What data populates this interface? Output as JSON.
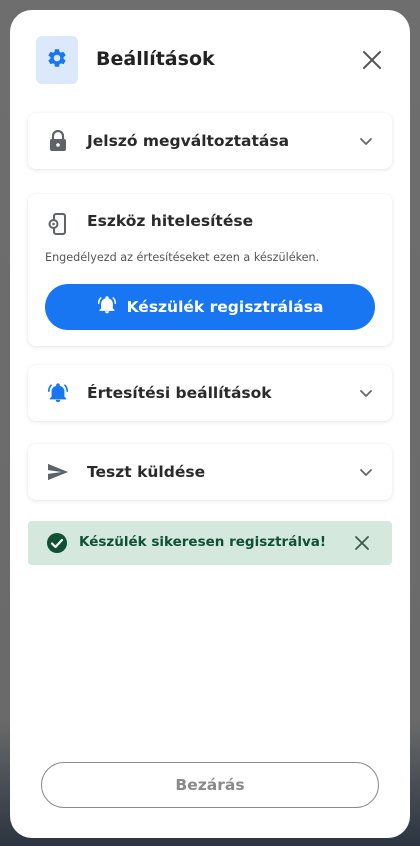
{
  "header": {
    "title": "Beállítások",
    "icon": "gear-icon",
    "close_icon": "close-icon"
  },
  "sections": {
    "password": {
      "label": "Jelszó megváltoztatása",
      "icon": "lock-icon"
    },
    "device": {
      "title": "Eszköz hitelesítése",
      "description": "Engedélyezd az értesítéseket ezen a készüléken.",
      "icon": "phone-settings-icon",
      "register_button": "Készülék regisztrálása",
      "register_icon": "bell-icon"
    },
    "notifications": {
      "label": "Értesítési beállítások",
      "icon": "bell-icon"
    },
    "test": {
      "label": "Teszt küldése",
      "icon": "send-icon"
    }
  },
  "alert": {
    "text": "Készülék sikeresen regisztrálva!",
    "icon": "check-circle-icon",
    "status_color": "#0f5132"
  },
  "footer": {
    "close_label": "Bezárás"
  },
  "colors": {
    "accent": "#1876f2",
    "success_bg": "#d4e8dd"
  }
}
